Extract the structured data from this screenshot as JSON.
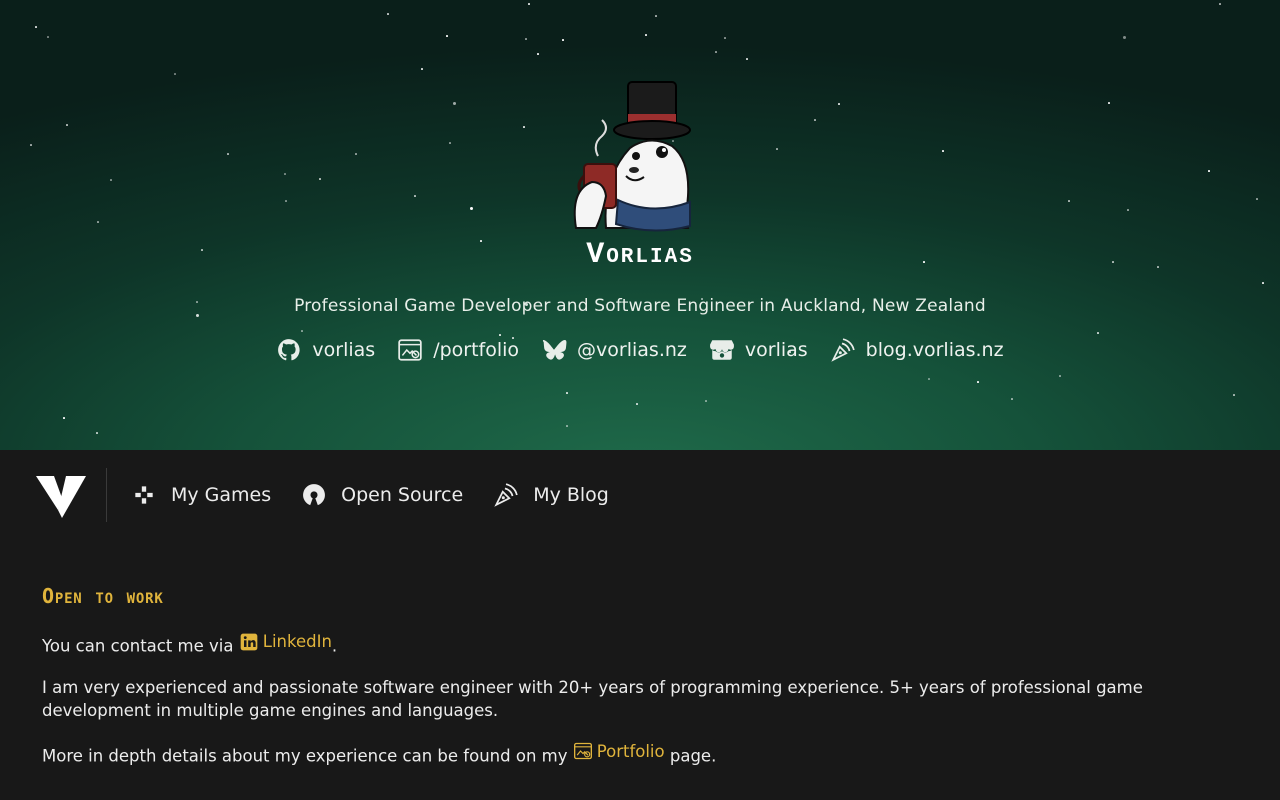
{
  "brand": {
    "name": "Vorlias"
  },
  "hero": {
    "tagline": "Professional Game Developer and Software Engineer in Auckland, New Zealand",
    "links": [
      {
        "icon": "github-icon",
        "label": "vorlias"
      },
      {
        "icon": "portfolio-icon",
        "label": "/portfolio"
      },
      {
        "icon": "bluesky-icon",
        "label": "@vorlias.nz"
      },
      {
        "icon": "itchio-icon",
        "label": "vorlias"
      },
      {
        "icon": "blog-pen-icon",
        "label": "blog.vorlias.nz"
      }
    ]
  },
  "nav": {
    "items": [
      {
        "icon": "gamepad-icon",
        "label": "My Games"
      },
      {
        "icon": "open-source-icon",
        "label": "Open Source"
      },
      {
        "icon": "pen-icon",
        "label": "My Blog"
      }
    ]
  },
  "main": {
    "heading": "Open to work",
    "contact_prefix": "You can contact me via ",
    "contact_link": "LinkedIn",
    "contact_suffix": ".",
    "experience": "I am very experienced and passionate software engineer with 20+ years of programming experience. 5+ years of professional game development in multiple game engines and languages.",
    "details_prefix": "More in depth details about my experience can be found on my ",
    "details_link": "Portfolio",
    "details_suffix": " page."
  },
  "colors": {
    "accent": "#e0b43c",
    "hero_green": "#1f6a4a",
    "background": "#181818"
  }
}
